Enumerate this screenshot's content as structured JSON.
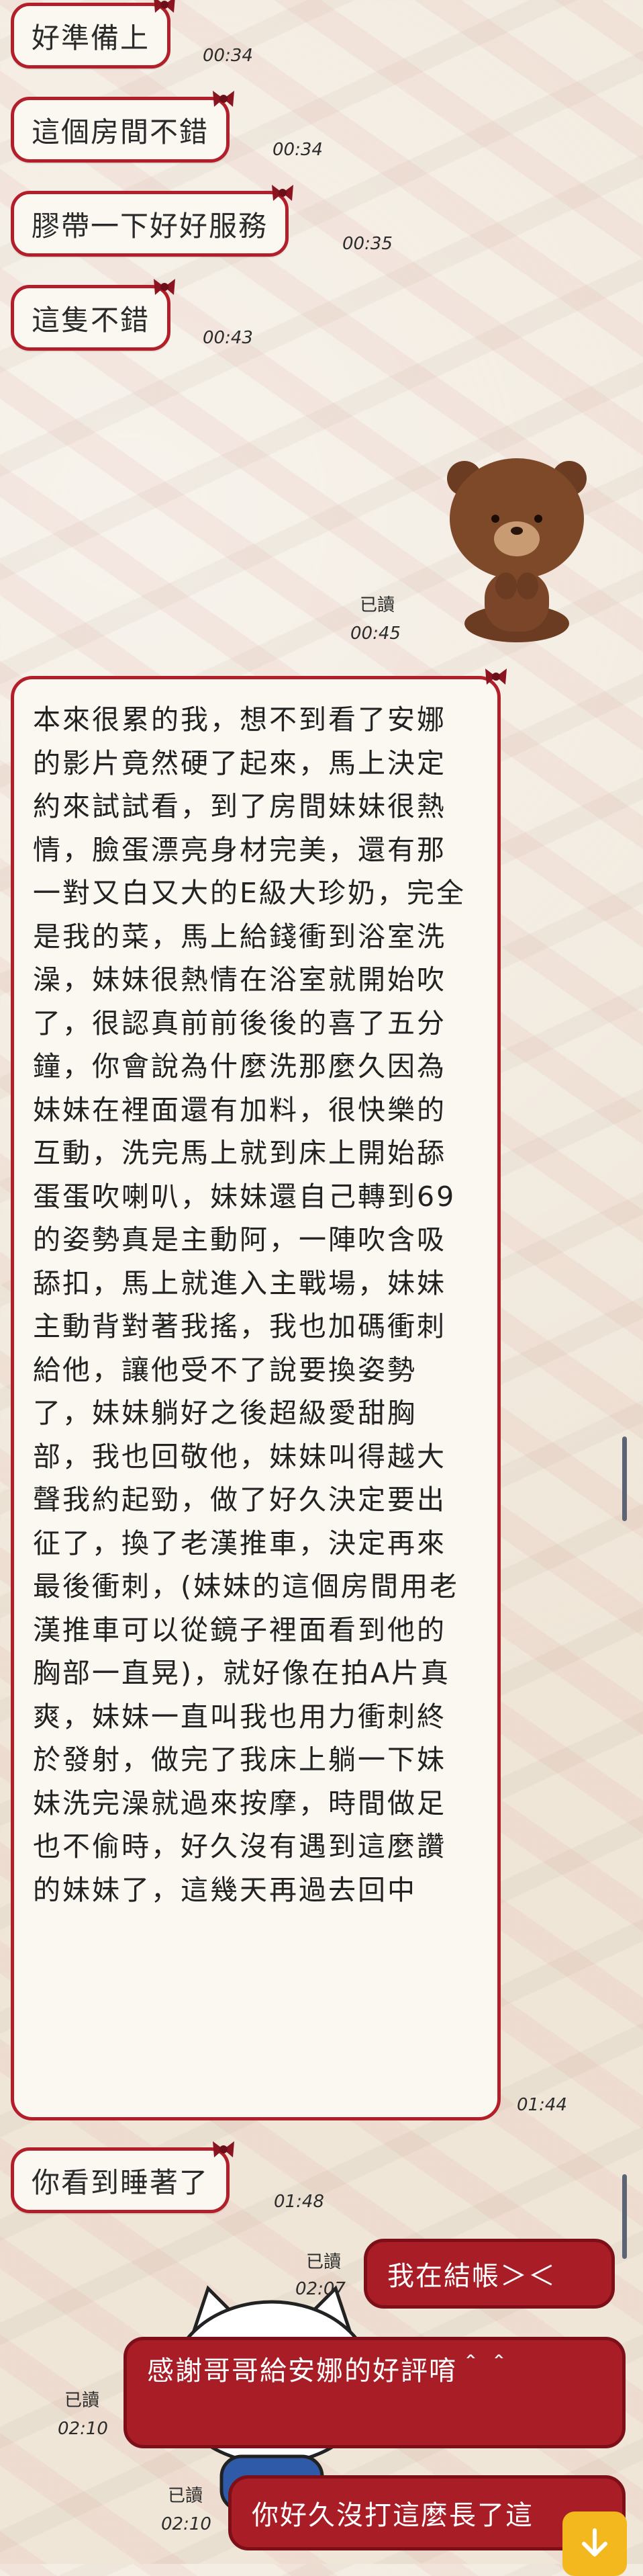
{
  "messages_in": [
    {
      "text": "好準備上",
      "time": "00:34"
    },
    {
      "text": "這個房間不錯",
      "time": "00:34"
    },
    {
      "text": "膠帶一下好好服務",
      "time": "00:35"
    },
    {
      "text": "這隻不錯",
      "time": "00:43"
    }
  ],
  "sticker_out": {
    "read": "已讀",
    "time": "00:45",
    "sticker": "brown-bear-sticker"
  },
  "long_message": {
    "text": "本來很累的我，想不到看了安娜的影片竟然硬了起來，馬上決定約來試試看，到了房間妹妹很熱情，臉蛋漂亮身材完美，還有那一對又白又大的E級大珍奶，完全是我的菜，馬上給錢衝到浴室洗澡，妹妹很熱情在浴室就開始吹了，很認真前前後後的喜了五分鐘，你會說為什麼洗那麼久因為妹妹在裡面還有加料，很快樂的互動，洗完馬上就到床上開始舔蛋蛋吹喇叭，妹妹還自己轉到69的姿勢真是主動阿，一陣吹含吸舔扣，馬上就進入主戰場，妹妹主動背對著我搖，我也加碼衝刺給他，讓他受不了說要換姿勢了，妹妹躺好之後超級愛甜胸部，我也回敬他，妹妹叫得越大聲我約起勁，做了好久決定要出征了，換了老漢推車，決定再來最後衝刺，(妹妹的這個房間用老漢推車可以從鏡子裡面看到他的胸部一直晃)，就好像在拍A片真爽，妹妹一直叫我也用力衝刺終於發射，做完了我床上躺一下妹妹洗完澡就過來按摩，時間做足也不偷時，好久沒有遇到這麼讚的妹妹了，這幾天再過去回中",
    "time": "01:44"
  },
  "message_after": {
    "text": "你看到睡著了",
    "time": "01:48"
  },
  "out_1": {
    "text": "我在結帳＞＜",
    "read": "已讀",
    "time": "02:07"
  },
  "out_2": {
    "text": "感謝哥哥給安娜的好評唷＾＾",
    "read": "已讀",
    "time": "02:10"
  },
  "out_3": {
    "text": "你好久沒打這麼長了這",
    "read": "已讀",
    "time": "02:10"
  },
  "scroll_down_icon": "arrow-down-icon",
  "colors": {
    "bubble_border": "#b21f2a",
    "out_bubble": "#a81d26",
    "fab": "#f3b81d"
  }
}
